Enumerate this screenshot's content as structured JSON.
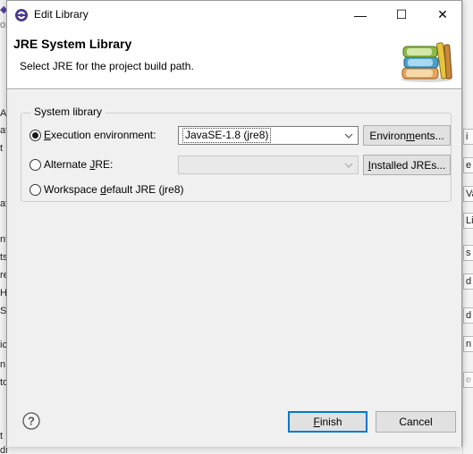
{
  "background": {
    "left_fragments": [
      "◆",
      "or",
      "A",
      "at",
      "t",
      "at",
      "nt",
      "ts",
      "re",
      "H",
      "S",
      "ic",
      "n",
      "to",
      "t",
      "ditor"
    ],
    "right_fragments": [
      "i",
      "e",
      "Va",
      "Li",
      "s",
      "d",
      "d",
      "n",
      "e"
    ]
  },
  "window": {
    "title": "Edit Library",
    "minimize_label": "—",
    "maximize_label": "☐",
    "close_label": "✕"
  },
  "header": {
    "title": "JRE System Library",
    "description": "Select JRE for the project build path."
  },
  "group": {
    "label": "System library",
    "options": [
      {
        "pre": "",
        "accel": "E",
        "post": "xecution environment:",
        "selected": true
      },
      {
        "pre": "Alternate ",
        "accel": "J",
        "post": "RE:",
        "selected": false
      },
      {
        "pre": "Workspace ",
        "accel": "d",
        "post": "efault JRE (jre8)",
        "selected": false
      }
    ],
    "env_combo_value": "JavaSE-1.8 (jre8)",
    "jre_combo_value": "",
    "environments_button": {
      "pre": "Environ",
      "accel": "m",
      "post": "ents..."
    },
    "installed_jres_button": {
      "pre": "",
      "accel": "I",
      "post": "nstalled JREs..."
    }
  },
  "footer": {
    "finish_button": {
      "pre": "",
      "accel": "F",
      "post": "inish"
    },
    "cancel_label": "Cancel"
  },
  "colors": {
    "accent": "#0078d7",
    "icon_purple": "#4b3a8c"
  }
}
